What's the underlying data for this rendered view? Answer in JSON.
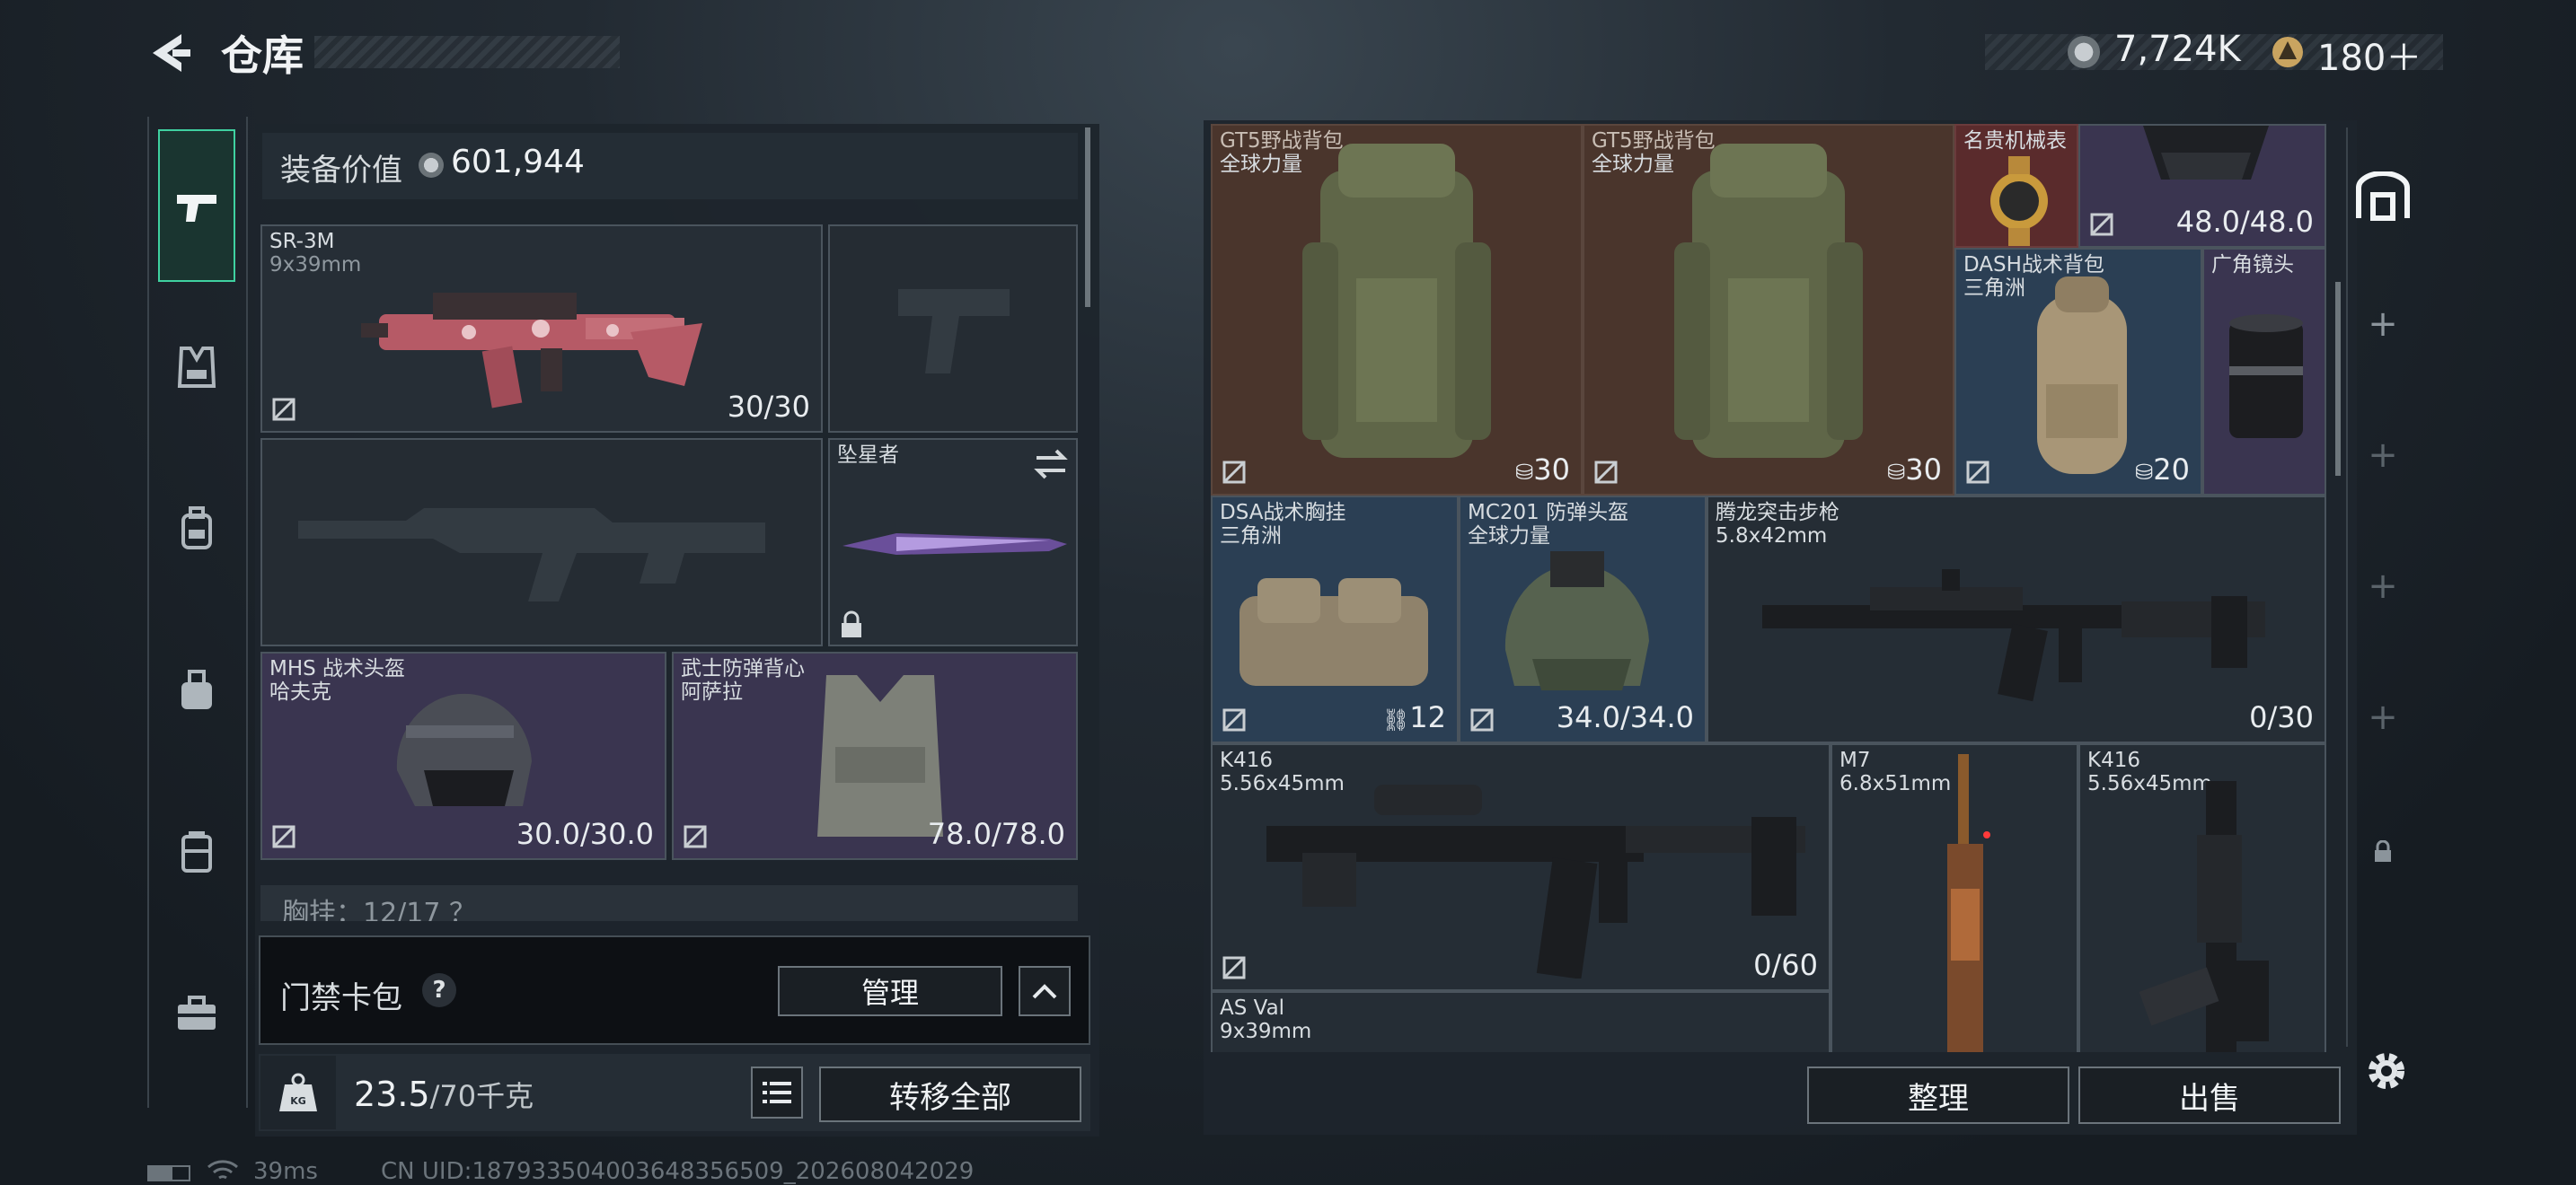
{
  "header": {
    "title": "仓库",
    "currency_a": "7,724K",
    "currency_b": "180＋"
  },
  "equip": {
    "value_label": "装备价值",
    "value": "601,944"
  },
  "loadout": {
    "primary": {
      "name": "SR-3M",
      "sub": "9x39mm",
      "count": "30/30"
    },
    "melee": {
      "name": "坠星者"
    },
    "helmet": {
      "name": "MHS 战术头盔",
      "sub": "哈夫克",
      "count": "30.0/30.0"
    },
    "armor": {
      "name": "武士防弹背心",
      "sub": "阿萨拉",
      "count": "78.0/78.0"
    },
    "chest_partial": "胸挂：12/17 ？"
  },
  "keycard": {
    "label": "门禁卡包",
    "help": "?",
    "manage": "管理"
  },
  "weight": {
    "value": "23.5",
    "max": "/70千克",
    "transfer_all": "转移全部"
  },
  "stash": {
    "items": [
      {
        "name": "GT5野战背包",
        "sub": "全球力量",
        "count": "30"
      },
      {
        "name": "GT5野战背包",
        "sub": "全球力量",
        "count": "30"
      },
      {
        "name": "名贵机械表",
        "sub": "",
        "count": ""
      },
      {
        "name": "",
        "sub": "",
        "count": "48.0/48.0"
      },
      {
        "name": "DASH战术背包",
        "sub": "三角洲",
        "count": "20"
      },
      {
        "name": "广角镜头",
        "sub": "",
        "count": ""
      },
      {
        "name": "DSA战术胸挂",
        "sub": "三角洲",
        "count": "12"
      },
      {
        "name": "MC201 防弹头盔",
        "sub": "全球力量",
        "count": "34.0/34.0"
      },
      {
        "name": "腾龙突击步枪",
        "sub": "5.8x42mm",
        "count": "0/30"
      },
      {
        "name": "K416",
        "sub": "5.56x45mm",
        "count": "0/60"
      },
      {
        "name": "M7",
        "sub": "6.8x51mm",
        "count": ""
      },
      {
        "name": "K416",
        "sub": "5.56x45mm",
        "count": ""
      },
      {
        "name": "AS Val",
        "sub": "9x39mm",
        "count": ""
      }
    ],
    "sort": "整理",
    "sell": "出售"
  },
  "status": {
    "ping": "39ms",
    "uid": "CN UID:18793350400364835650​9_202608042029"
  },
  "colors": {
    "accent_green": "#3fd1a0",
    "panel": "#202830",
    "rare_purple": "#3a3550",
    "gold_bg": "#4a2a22"
  }
}
